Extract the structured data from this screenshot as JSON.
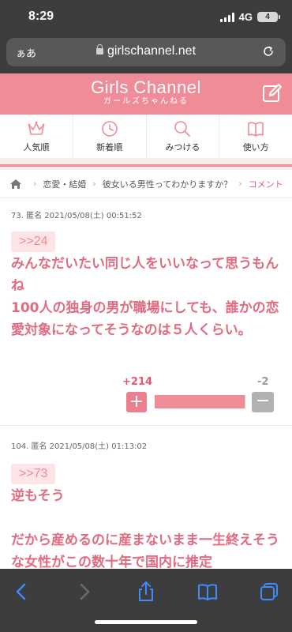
{
  "status_bar": {
    "time": "8:29",
    "network": "4G",
    "battery": "4"
  },
  "browser": {
    "aa_label": "ぁあ",
    "url": "girlschannel.net"
  },
  "site": {
    "logo_main": "Girls Channel",
    "logo_sub": "ガールズちゃんねる"
  },
  "nav": {
    "items": [
      {
        "label": "人気順",
        "icon": "crown-icon"
      },
      {
        "label": "新着順",
        "icon": "clock-icon"
      },
      {
        "label": "みつける",
        "icon": "search-icon"
      },
      {
        "label": "使い方",
        "icon": "book-icon"
      }
    ]
  },
  "breadcrumb": {
    "items": [
      "恋愛・結婚",
      "彼女いる男性ってわかりますか？",
      "コメント"
    ]
  },
  "comments": [
    {
      "meta": "73. 匿名 2021/05/08(土) 00:51:52",
      "reply_to": ">>24",
      "body": "みんなだいたい同じ人をいいなって思うもんね\n100人の独身の男が職場にしても、誰かの恋愛対象になってそうなのは５人くらい。",
      "plus": "+214",
      "minus": "-2",
      "plus_fraction": 0.99
    },
    {
      "meta": "104. 匿名 2021/05/08(土) 01:13:02",
      "reply_to": ">>73",
      "body": "逆もそう\n\nだから産めるのに産まないまま一生終えそうな女性がこの数十年で国内に推定"
    }
  ],
  "colors": {
    "brand_pink": "#f08c98",
    "comment_text": "#e26b80",
    "chrome": "#3d3d3f"
  }
}
